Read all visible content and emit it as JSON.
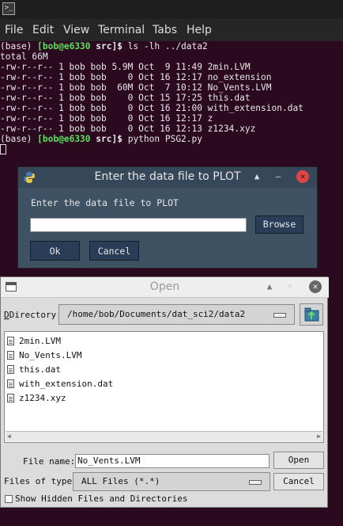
{
  "window": {
    "title_logo": ">_"
  },
  "menubar": {
    "items": [
      "File",
      "Edit",
      "View",
      "Terminal",
      "Tabs",
      "Help"
    ]
  },
  "terminal": {
    "env": "(base)",
    "user_host": "[bob@e6330",
    "cwd": "src]$",
    "cmd1": " ls -lh ../data2",
    "total": "total 66M",
    "files": [
      "-rw-r--r-- 1 bob bob 5.9M Oct  9 11:49 2min.LVM",
      "-rw-r--r-- 1 bob bob    0 Oct 16 12:17 no_extension",
      "-rw-r--r-- 1 bob bob  60M Oct  7 10:12 No_Vents.LVM",
      "-rw-r--r-- 1 bob bob    0 Oct 15 17:25 this.dat",
      "-rw-r--r-- 1 bob bob    0 Oct 16 21:00 with_extension.dat",
      "-rw-r--r-- 1 bob bob    0 Oct 16 12:17 z",
      "-rw-r--r-- 1 bob bob    0 Oct 16 12:13 z1234.xyz"
    ],
    "cmd2": " python PSG2.py"
  },
  "plot_dialog": {
    "title": "Enter the data file to PLOT",
    "prompt": "Enter the data file to PLOT",
    "input_value": "",
    "browse_label": "Browse",
    "ok_label": "Ok",
    "cancel_label": "Cancel",
    "title_buttons": {
      "shade": "▲",
      "minimize": "–",
      "close": "✕"
    }
  },
  "open_dialog": {
    "title": "Open",
    "directory_label": "Directory:",
    "directory_value": "/home/bob/Documents/dat_sci2/data2",
    "files": [
      "2min.LVM",
      "No_Vents.LVM",
      "this.dat",
      "with_extension.dat",
      "z1234.xyz"
    ],
    "filename_label": "File name:",
    "filename_value": "No_Vents.LVM",
    "open_label": "Open",
    "filetype_label": "Files of type:",
    "filetype_value": "ALL Files (*.*)",
    "cancel_label": "Cancel",
    "hidden_label": "Show Hidden Files and Directories",
    "show_hidden": false,
    "title_buttons": {
      "shade": "▲",
      "minimize": "◦",
      "close": "✕"
    }
  }
}
